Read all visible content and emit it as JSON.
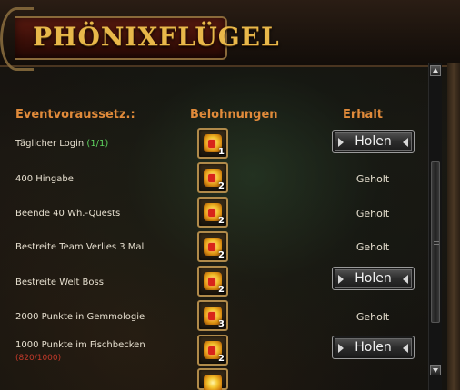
{
  "window": {
    "title": "PHÖNIXFLÜGEL"
  },
  "columns": {
    "conditions": "Eventvoraussetz.:",
    "rewards": "Belohnungen",
    "received": "Erhalt"
  },
  "colors": {
    "header_text": "#e08a3a",
    "title_gold": "#e8b84a",
    "progress_ok": "#5ed35e",
    "progress_bad": "#c43a2a"
  },
  "rows": [
    {
      "label": "Täglicher Login",
      "progress": "(1/1)",
      "reward_count": "1",
      "status": "claim",
      "button": "Holen"
    },
    {
      "label": "400 Hingabe",
      "reward_count": "2",
      "status": "claimed",
      "status_text": "Geholt"
    },
    {
      "label": "Beende 40 Wh.-Quests",
      "reward_count": "2",
      "status": "claimed",
      "status_text": "Geholt"
    },
    {
      "label": "Bestreite Team Verlies 3 Mal",
      "reward_count": "2",
      "status": "claimed",
      "status_text": "Geholt"
    },
    {
      "label": "Bestreite Welt Boss",
      "reward_count": "2",
      "status": "claim",
      "button": "Holen"
    },
    {
      "label": "2000 Punkte in Gemmologie",
      "reward_count": "3",
      "status": "claimed",
      "status_text": "Geholt"
    },
    {
      "label": "1000 Punkte im Fischbecken",
      "sub_progress": "(820/1000)",
      "reward_count": "2",
      "status": "claim",
      "button": "Holen"
    }
  ],
  "icons": {
    "reward": "treasure-chest-icon",
    "scroll_up": "arrow-up-icon",
    "scroll_down": "arrow-down-icon"
  }
}
